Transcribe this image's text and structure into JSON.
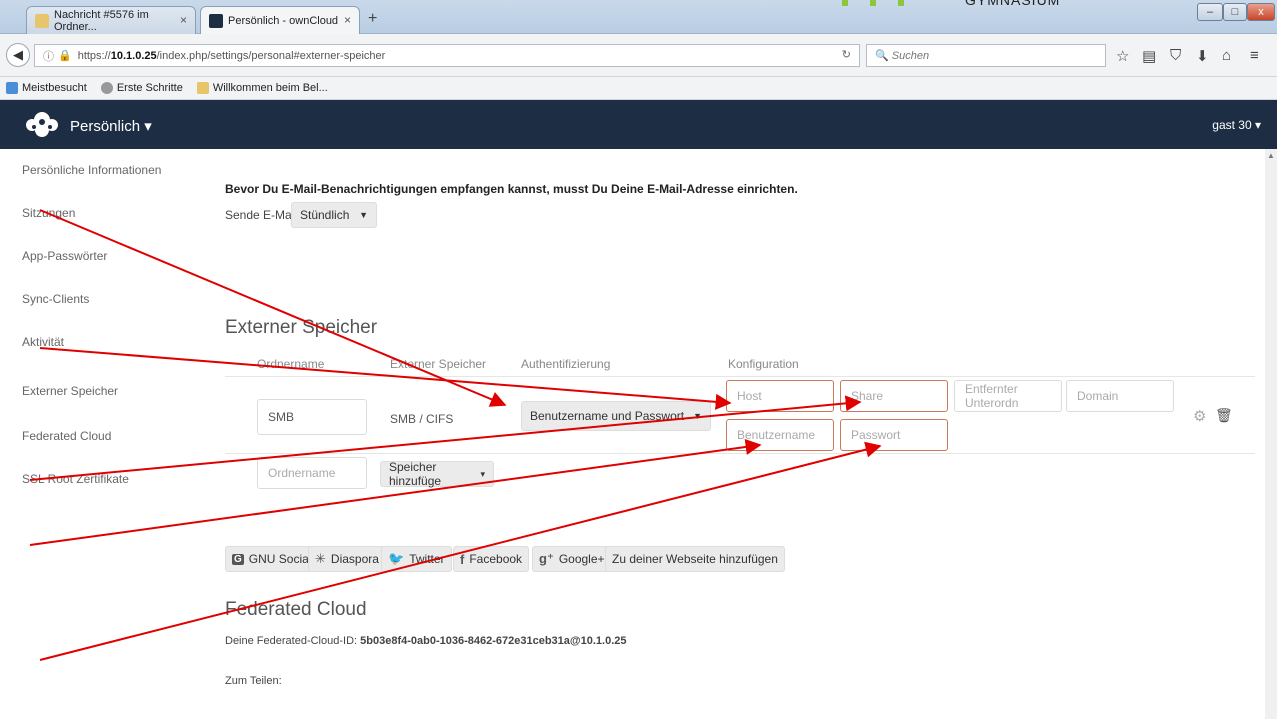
{
  "browser": {
    "tabs": [
      {
        "label": "Nachricht #5576 im Ordner...",
        "active": false
      },
      {
        "label": "Persönlich - ownCloud",
        "active": true
      }
    ],
    "new_tab": "+",
    "branding_text": "GYMNASIUM",
    "url_prefix": "https://",
    "url_host": "10.1.0.25",
    "url_path": "/index.php/settings/personal#externer-speicher",
    "search_placeholder": "Suchen",
    "bookmarks": [
      "Meistbesucht",
      "Erste Schritte",
      "Willkommen beim Bel..."
    ]
  },
  "app": {
    "title": "Persönlich",
    "user": "gast 30",
    "colors": {
      "header": "#1d2d44",
      "arrow": "#e00000",
      "required_border": "#c97a5b"
    }
  },
  "sidebar": {
    "items": [
      "Persönliche Informationen",
      "Sitzungen",
      "App-Passwörter",
      "Sync-Clients",
      "Aktivität",
      "Externer Speicher",
      "Federated Cloud",
      "SSL Root Zertifikate"
    ]
  },
  "email": {
    "hint": "Bevor Du E-Mail-Benachrichtigungen empfangen kannst, musst Du Deine E-Mail-Adresse einrichten.",
    "send_label": "Sende E-Mails:",
    "send_value": "Stündlich"
  },
  "external_storage": {
    "title": "Externer Speicher",
    "headers": [
      "Ordnername",
      "Externer Speicher",
      "Authentifizierung",
      "Konfiguration"
    ],
    "row": {
      "folder": "SMB",
      "storage": "SMB / CIFS",
      "auth": "Benutzername und Passwort",
      "host_ph": "Host",
      "share_ph": "Share",
      "subfolder_ph": "Entfernter Unterordn",
      "domain_ph": "Domain",
      "user_ph": "Benutzername",
      "password_ph": "Passwort"
    },
    "new_folder_ph": "Ordnername",
    "add_storage": "Speicher hinzufüge"
  },
  "federated": {
    "title": "Federated Cloud",
    "id_label": "Deine Federated-Cloud-ID:",
    "id_value": "5b03e8f4-0ab0-1036-8462-672e31ceb31a@10.1.0.25",
    "share_label": "Zum Teilen:",
    "buttons": [
      "GNU Social",
      "Diaspora",
      "Twitter",
      "Facebook",
      "Google+",
      "Zu deiner Webseite hinzufügen"
    ]
  }
}
